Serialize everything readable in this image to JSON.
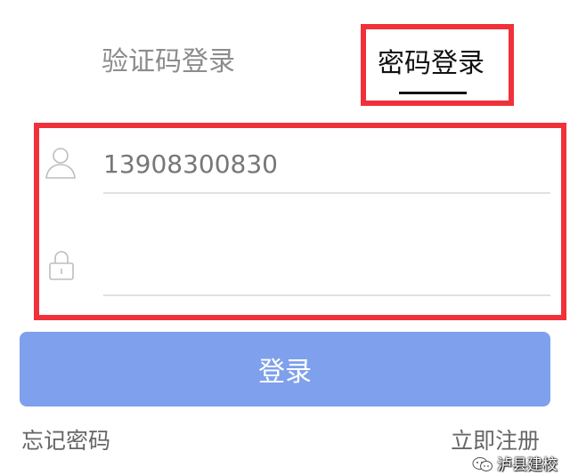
{
  "tabs": [
    {
      "label": "验证码登录",
      "selected": false
    },
    {
      "label": "密码登录",
      "selected": true
    }
  ],
  "phone_field": {
    "value": "13908300830",
    "placeholder": ""
  },
  "password_field": {
    "value": "",
    "placeholder": ""
  },
  "login_button": {
    "label": "登录"
  },
  "links": {
    "forgot_password": "忘记密码",
    "register": "立即注册"
  },
  "watermark": {
    "text": "泸县建校"
  },
  "icons": {
    "user": "user-icon",
    "lock": "lock-icon",
    "watermark": "wechat-icon"
  },
  "colors": {
    "highlight": "#f0313a",
    "button": "#7fa0ec",
    "tab_active": "#111111",
    "tab_inactive": "#8c8c8c",
    "link": "#666666"
  }
}
